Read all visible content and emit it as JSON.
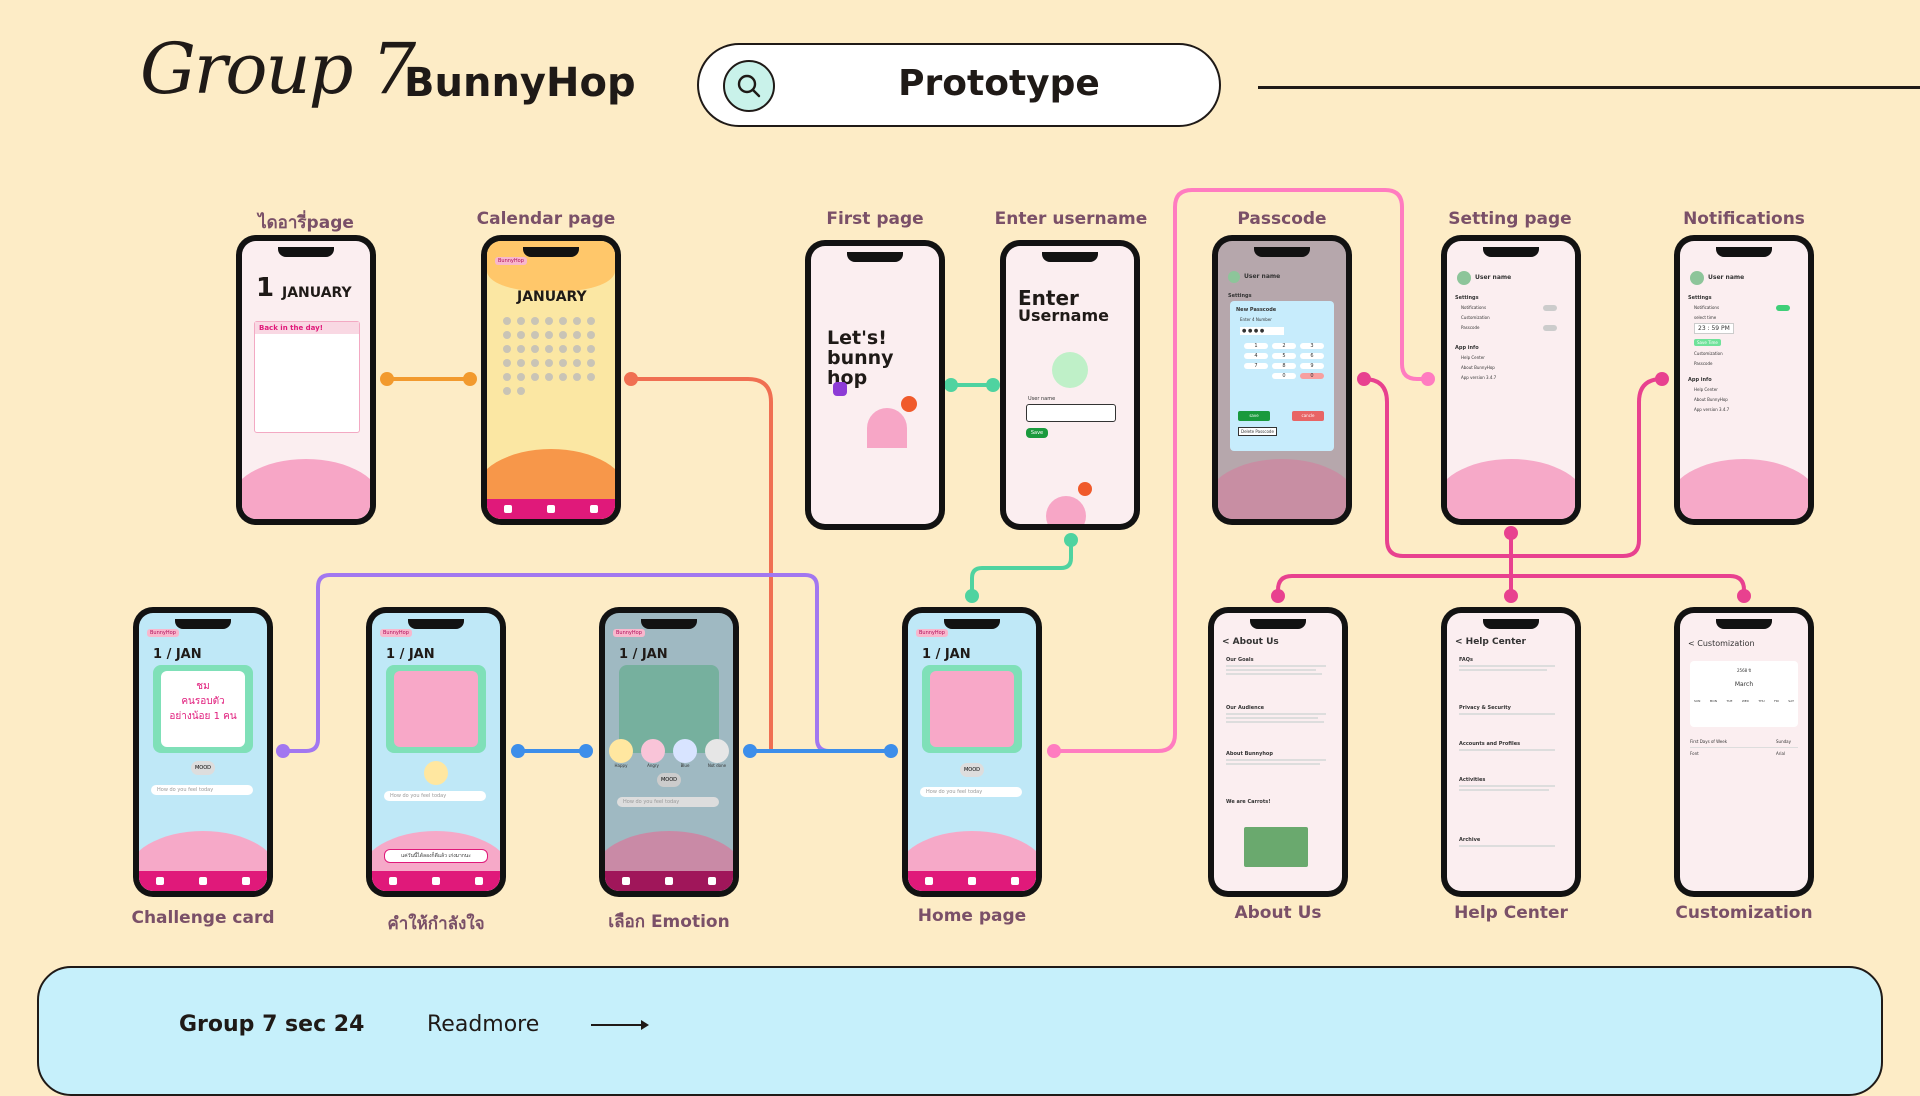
{
  "header": {
    "group_script": "Group 7",
    "app_name": "BunnyHop",
    "search_label": "Prototype"
  },
  "screens": {
    "diary": {
      "label": "ไดอารี่page",
      "day": "1",
      "month": "JANUARY",
      "note_title": "Back in the day!"
    },
    "calendar": {
      "label": "Calendar page",
      "month": "JANUARY",
      "tag": "BunnyHop"
    },
    "first": {
      "label": "First page",
      "line1": "Let's!",
      "line2": "bunny",
      "line3": "hop"
    },
    "username": {
      "label": "Enter username",
      "title1": "Enter",
      "title2": "Username",
      "field_label": "User name",
      "button": "Save"
    },
    "passcode": {
      "label": "Passcode",
      "user": "User name",
      "section": "Settings",
      "panel_title": "New Passcode",
      "panel_sub": "Enter 4 Number",
      "digits": "● ● ● ●",
      "keys": [
        "1",
        "2",
        "3",
        "4",
        "5",
        "6",
        "7",
        "8",
        "9",
        "0",
        "0"
      ],
      "save": "save",
      "cancel": "cancle",
      "delete": "Delete Passcode"
    },
    "settings": {
      "label": "Setting page",
      "user": "User name",
      "section": "Settings",
      "items": [
        "Notifications",
        "Customization",
        "Passcode"
      ],
      "about_section": "App info",
      "about_items": [
        "Help Center",
        "About BunnyHop",
        "App version 3.4.7"
      ]
    },
    "notifications": {
      "label": "Notifications",
      "user": "User name",
      "section": "Settings",
      "items": [
        "Notifications",
        "select time"
      ],
      "time": "23 : 59  PM",
      "chip": "Save Time",
      "sub_items": [
        "Customization",
        "Passcode"
      ],
      "about_section": "App info",
      "about_items": [
        "Help Center",
        "About BunnyHop",
        "App version 3.4.7"
      ]
    },
    "challenge": {
      "label": "Challenge card",
      "tag": "BunnyHop",
      "date": "1 / JAN",
      "card_line1": "ชม",
      "card_line2": "คนรอบตัว",
      "card_line3": "อย่างน้อย 1 คน",
      "mood": "MOOD",
      "prompt": "How do you feel today"
    },
    "encourage": {
      "label": "คำให้กำลังใจ",
      "tag": "BunnyHop",
      "date": "1 / JAN",
      "mood": "MOOD",
      "prompt": "How do you feel today",
      "quote": "แค่วันนี้ได้ลองก็ดีแล้ว เก่งมากนะ"
    },
    "emotion": {
      "label": "เลือก Emotion",
      "tag": "BunnyHop",
      "date": "1 / JAN",
      "mood": "MOOD",
      "prompt": "How do you feel today",
      "faces": [
        "Happy",
        "Angry",
        "Blue",
        "Not done"
      ]
    },
    "home": {
      "label": "Home page",
      "tag": "BunnyHop",
      "date": "1 / JAN",
      "mood": "MOOD",
      "prompt": "How do you feel today"
    },
    "about": {
      "label": "About Us",
      "header": "< About Us",
      "sections": [
        "Our Goals",
        "Our Audience",
        "About Bunnyhop",
        "We are Carrots!"
      ]
    },
    "help": {
      "label": "Help Center",
      "header": "< Help Center",
      "sections": [
        "FAQs",
        "Privacy & Security",
        "Accounts and Profiles",
        "Activities",
        "Archive"
      ]
    },
    "custom": {
      "label": "Customization",
      "header": "< Customization",
      "year": "2568 ปี",
      "month": "March",
      "days": [
        "SUN",
        "MON",
        "TUE",
        "WED",
        "THU",
        "FRI",
        "SAT"
      ],
      "row1": "First Days of Week",
      "row1_val": "Sunday",
      "row2": "Font",
      "row2_val": "Arial"
    }
  },
  "footer": {
    "group": "Group 7 sec 24",
    "readmore": "Readmore"
  },
  "colors": {
    "background": "#fdecc6",
    "footer": "#c6f0fb",
    "pink": "#e0197a",
    "orange": "#f29a2e",
    "salmon": "#f06f52",
    "blue": "#3d8eea",
    "purple": "#a277f0",
    "green": "#4fd3a0",
    "magenta": "#ff4f9e"
  }
}
